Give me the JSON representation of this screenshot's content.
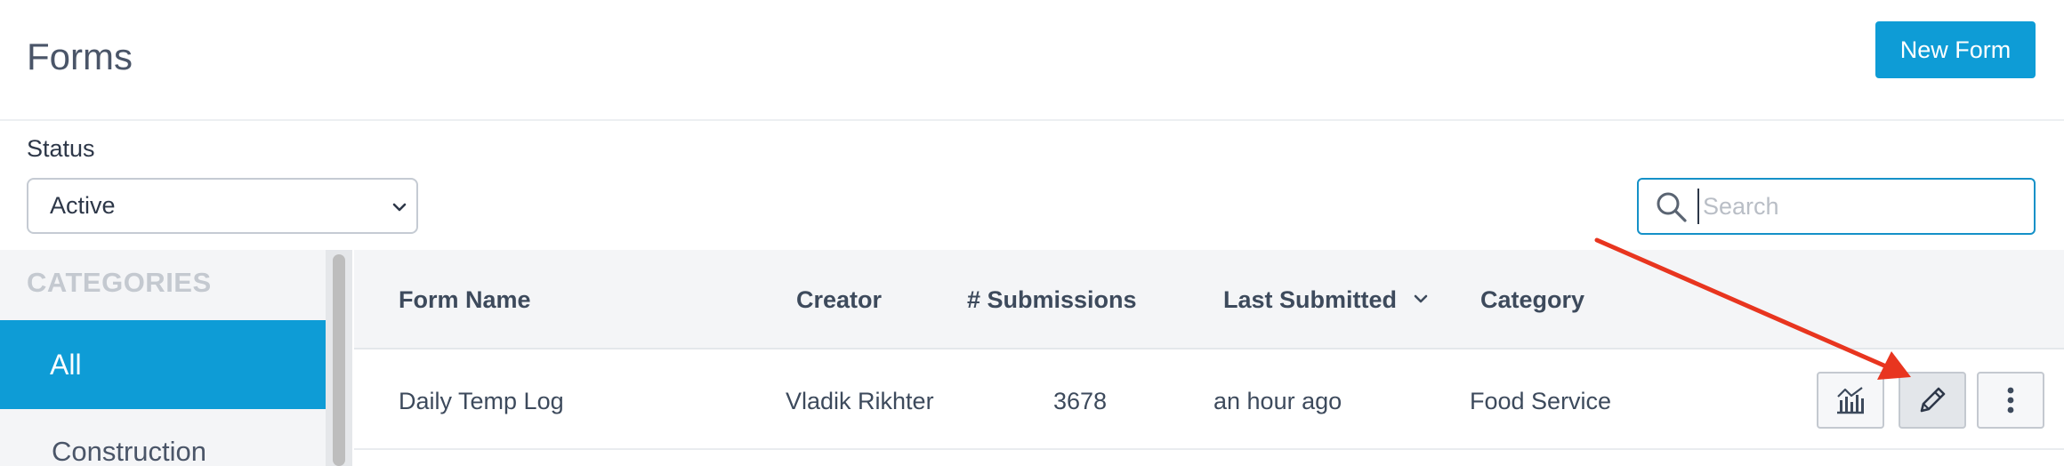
{
  "header": {
    "title": "Forms",
    "new_form_label": "New Form"
  },
  "filters": {
    "status_label": "Status",
    "status_value": "Active",
    "search_placeholder": "Search"
  },
  "sidebar": {
    "heading": "CATEGORIES",
    "items": [
      {
        "label": "All",
        "selected": true
      },
      {
        "label": "Construction",
        "selected": false
      }
    ]
  },
  "table": {
    "columns": [
      "Form Name",
      "Creator",
      "# Submissions",
      "Last Submitted",
      "Category"
    ],
    "sorted_column": "Last Submitted",
    "rows": [
      {
        "form_name": "Daily Temp Log",
        "creator": "Vladik Rikhter",
        "submissions": "3678",
        "last_submitted": "an hour ago",
        "category": "Food Service",
        "actions": [
          "chart-icon",
          "pencil-icon",
          "more-vertical-icon"
        ]
      }
    ]
  },
  "colors": {
    "accent": "#0e9cd6",
    "annotation_arrow": "#e8351f"
  }
}
